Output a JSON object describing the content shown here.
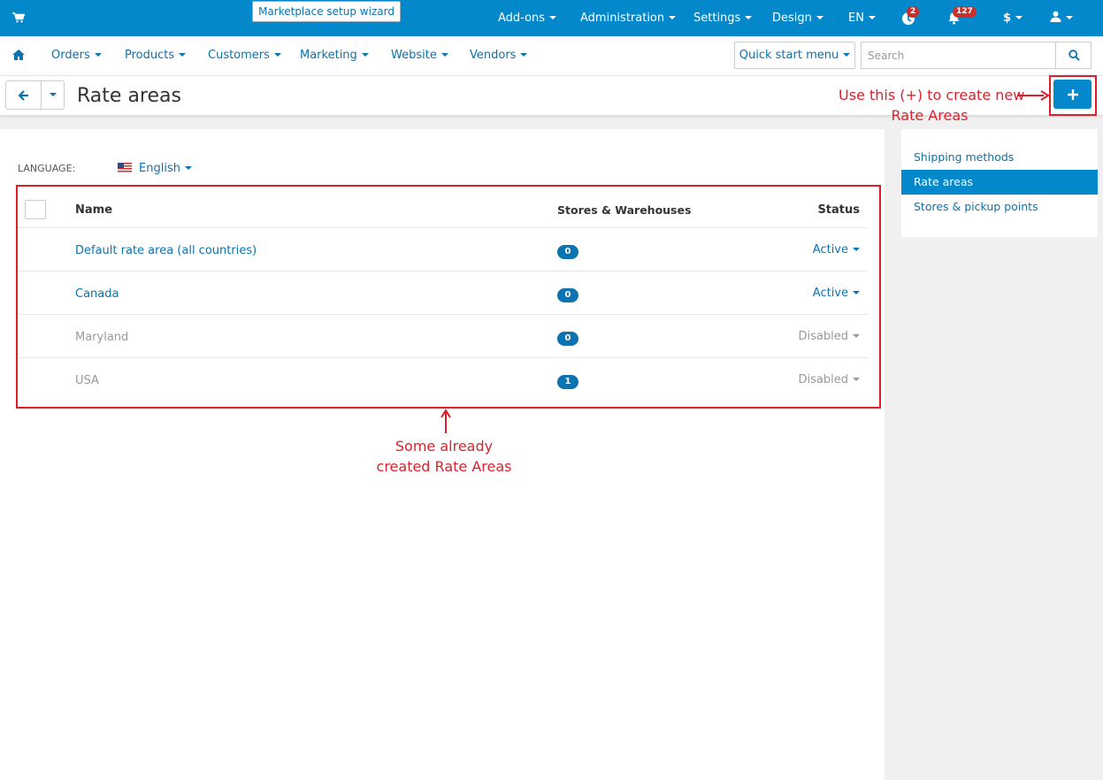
{
  "topbar": {
    "wizard_label": "Marketplace setup wizard",
    "nav": [
      {
        "label": "Add-ons"
      },
      {
        "label": "Administration"
      },
      {
        "label": "Settings"
      },
      {
        "label": "Design"
      },
      {
        "label": "EN"
      }
    ],
    "update_badge": "2",
    "notification_badge": "127",
    "currency_label": "$"
  },
  "subnav": {
    "items": [
      {
        "label": "Orders"
      },
      {
        "label": "Products"
      },
      {
        "label": "Customers"
      },
      {
        "label": "Marketing"
      },
      {
        "label": "Website"
      },
      {
        "label": "Vendors"
      }
    ],
    "quick_start_label": "Quick start menu",
    "search_placeholder": "Search"
  },
  "titlebar": {
    "title": "Rate areas"
  },
  "main": {
    "language_label": "LANGUAGE:",
    "language_value": "English",
    "columns": {
      "name": "Name",
      "stores": "Stores & Warehouses",
      "status": "Status"
    },
    "rows": [
      {
        "name": "Default rate area (all countries)",
        "stores": "0",
        "status": "Active"
      },
      {
        "name": "Canada",
        "stores": "0",
        "status": "Active"
      },
      {
        "name": "Maryland",
        "stores": "0",
        "status": "Disabled"
      },
      {
        "name": "USA",
        "stores": "1",
        "status": "Disabled"
      }
    ]
  },
  "sidebar": {
    "items": [
      {
        "label": "Shipping methods"
      },
      {
        "label": "Rate areas"
      },
      {
        "label": "Stores & pickup points"
      }
    ]
  },
  "annotations": {
    "add_note_line1": "Use this (+) to create new",
    "add_note_line2": "Rate Areas",
    "table_note_line1": "Some already",
    "table_note_line2": "created Rate Areas"
  },
  "colors": {
    "primary": "#0388cc",
    "link": "#0b73b0",
    "annotation": "#e01e2a"
  }
}
